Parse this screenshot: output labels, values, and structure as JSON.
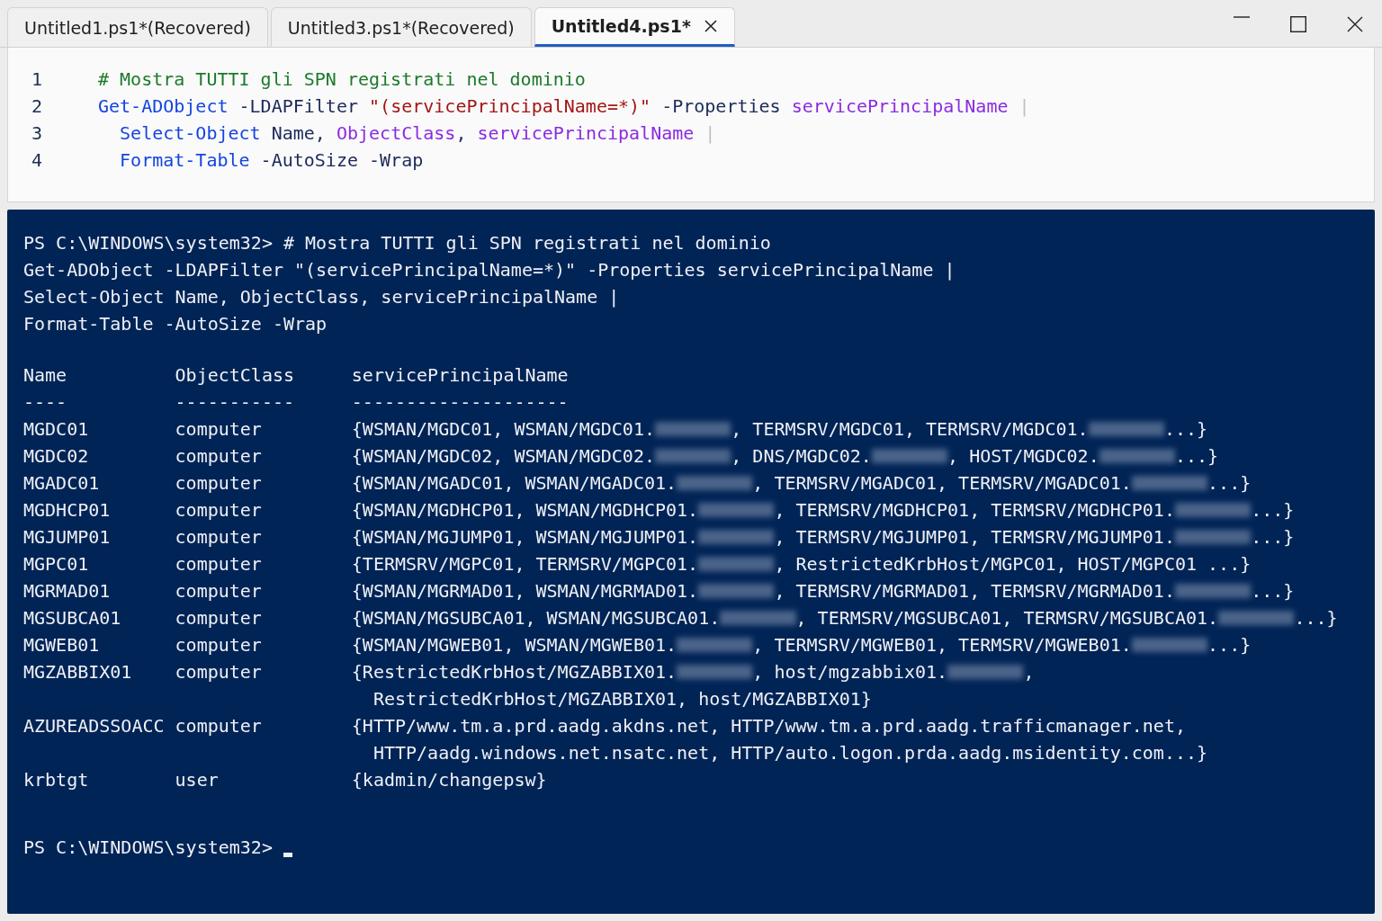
{
  "tabs": [
    {
      "label": "Untitled1.ps1*(Recovered)",
      "selected": false
    },
    {
      "label": "Untitled3.ps1*(Recovered)",
      "selected": false
    },
    {
      "label": "Untitled4.ps1*",
      "selected": true
    }
  ],
  "editor": {
    "lines": [
      {
        "number": "1",
        "tokens": [
          {
            "kind": "comment",
            "text": "# Mostra TUTTI gli SPN registrati nel dominio"
          }
        ]
      },
      {
        "number": "2",
        "tokens": [
          {
            "kind": "cmdlet",
            "text": "Get-ADObject"
          },
          {
            "kind": "param",
            "text": " -LDAPFilter "
          },
          {
            "kind": "string",
            "text": "\"(servicePrincipalName=*)\""
          },
          {
            "kind": "param",
            "text": " -Properties "
          },
          {
            "kind": "property",
            "text": "servicePrincipalName"
          },
          {
            "kind": "pipe",
            "text": " |"
          }
        ]
      },
      {
        "number": "3",
        "tokens": [
          {
            "kind": "cmdlet",
            "text": "  Select-Object"
          },
          {
            "kind": "param",
            "text": " Name, "
          },
          {
            "kind": "property",
            "text": "ObjectClass"
          },
          {
            "kind": "param",
            "text": ", "
          },
          {
            "kind": "property",
            "text": "servicePrincipalName"
          },
          {
            "kind": "pipe",
            "text": " |"
          }
        ]
      },
      {
        "number": "4",
        "tokens": [
          {
            "kind": "cmdlet",
            "text": "  Format-Table"
          },
          {
            "kind": "param",
            "text": " -AutoSize -Wrap"
          }
        ]
      }
    ]
  },
  "console": {
    "echo": [
      "PS C:\\WINDOWS\\system32> # Mostra TUTTI gli SPN registrati nel dominio",
      "Get-ADObject -LDAPFilter \"(servicePrincipalName=*)\" -Properties servicePrincipalName |",
      "Select-Object Name, ObjectClass, servicePrincipalName |",
      "Format-Table -AutoSize -Wrap"
    ],
    "table": {
      "columns": [
        "Name",
        "ObjectClass",
        "servicePrincipalName"
      ],
      "underlines": [
        "----",
        "-----------",
        "--------------------"
      ],
      "rows": [
        {
          "name": "MGDC01",
          "object_class": "computer",
          "spn_lines": [
            [
              {
                "kind": "text",
                "text": "{WSMAN/MGDC01, WSMAN/MGDC01."
              },
              {
                "kind": "redacted"
              },
              {
                "kind": "text",
                "text": ", TERMSRV/MGDC01, TERMSRV/MGDC01."
              },
              {
                "kind": "redacted"
              },
              {
                "kind": "text",
                "text": "...}"
              }
            ]
          ]
        },
        {
          "name": "MGDC02",
          "object_class": "computer",
          "spn_lines": [
            [
              {
                "kind": "text",
                "text": "{WSMAN/MGDC02, WSMAN/MGDC02."
              },
              {
                "kind": "redacted"
              },
              {
                "kind": "text",
                "text": ", DNS/MGDC02."
              },
              {
                "kind": "redacted"
              },
              {
                "kind": "text",
                "text": ", HOST/MGDC02."
              },
              {
                "kind": "redacted"
              },
              {
                "kind": "text",
                "text": "...}"
              }
            ]
          ]
        },
        {
          "name": "MGADC01",
          "object_class": "computer",
          "spn_lines": [
            [
              {
                "kind": "text",
                "text": "{WSMAN/MGADC01, WSMAN/MGADC01."
              },
              {
                "kind": "redacted"
              },
              {
                "kind": "text",
                "text": ", TERMSRV/MGADC01, TERMSRV/MGADC01."
              },
              {
                "kind": "redacted"
              },
              {
                "kind": "text",
                "text": "...}"
              }
            ]
          ]
        },
        {
          "name": "MGDHCP01",
          "object_class": "computer",
          "spn_lines": [
            [
              {
                "kind": "text",
                "text": "{WSMAN/MGDHCP01, WSMAN/MGDHCP01."
              },
              {
                "kind": "redacted"
              },
              {
                "kind": "text",
                "text": ", TERMSRV/MGDHCP01, TERMSRV/MGDHCP01."
              },
              {
                "kind": "redacted"
              },
              {
                "kind": "text",
                "text": "...}"
              }
            ]
          ]
        },
        {
          "name": "MGJUMP01",
          "object_class": "computer",
          "spn_lines": [
            [
              {
                "kind": "text",
                "text": "{WSMAN/MGJUMP01, WSMAN/MGJUMP01."
              },
              {
                "kind": "redacted"
              },
              {
                "kind": "text",
                "text": ", TERMSRV/MGJUMP01, TERMSRV/MGJUMP01."
              },
              {
                "kind": "redacted"
              },
              {
                "kind": "text",
                "text": "...}"
              }
            ]
          ]
        },
        {
          "name": "MGPC01",
          "object_class": "computer",
          "spn_lines": [
            [
              {
                "kind": "text",
                "text": "{TERMSRV/MGPC01, TERMSRV/MGPC01."
              },
              {
                "kind": "redacted"
              },
              {
                "kind": "text",
                "text": ", RestrictedKrbHost/MGPC01, HOST/MGPC01 ...}"
              }
            ]
          ]
        },
        {
          "name": "MGRMAD01",
          "object_class": "computer",
          "spn_lines": [
            [
              {
                "kind": "text",
                "text": "{WSMAN/MGRMAD01, WSMAN/MGRMAD01."
              },
              {
                "kind": "redacted"
              },
              {
                "kind": "text",
                "text": ", TERMSRV/MGRMAD01, TERMSRV/MGRMAD01."
              },
              {
                "kind": "redacted"
              },
              {
                "kind": "text",
                "text": "...}"
              }
            ]
          ]
        },
        {
          "name": "MGSUBCA01",
          "object_class": "computer",
          "spn_lines": [
            [
              {
                "kind": "text",
                "text": "{WSMAN/MGSUBCA01, WSMAN/MGSUBCA01."
              },
              {
                "kind": "redacted"
              },
              {
                "kind": "text",
                "text": ", TERMSRV/MGSUBCA01, TERMSRV/MGSUBCA01."
              },
              {
                "kind": "redacted"
              },
              {
                "kind": "text",
                "text": "...}"
              }
            ]
          ]
        },
        {
          "name": "MGWEB01",
          "object_class": "computer",
          "spn_lines": [
            [
              {
                "kind": "text",
                "text": "{WSMAN/MGWEB01, WSMAN/MGWEB01."
              },
              {
                "kind": "redacted"
              },
              {
                "kind": "text",
                "text": ", TERMSRV/MGWEB01, TERMSRV/MGWEB01."
              },
              {
                "kind": "redacted"
              },
              {
                "kind": "text",
                "text": "...}"
              }
            ]
          ]
        },
        {
          "name": "MGZABBIX01",
          "object_class": "computer",
          "spn_lines": [
            [
              {
                "kind": "text",
                "text": "{RestrictedKrbHost/MGZABBIX01."
              },
              {
                "kind": "redacted"
              },
              {
                "kind": "text",
                "text": ", host/mgzabbix01."
              },
              {
                "kind": "redacted"
              },
              {
                "kind": "text",
                "text": ","
              }
            ],
            [
              {
                "kind": "text",
                "text": "RestrictedKrbHost/MGZABBIX01, host/MGZABBIX01}"
              }
            ]
          ]
        },
        {
          "name": "AZUREADSSOACC",
          "object_class": "computer",
          "spn_lines": [
            [
              {
                "kind": "text",
                "text": "{HTTP/www.tm.a.prd.aadg.akdns.net, HTTP/www.tm.a.prd.aadg.trafficmanager.net,"
              }
            ],
            [
              {
                "kind": "text",
                "text": "HTTP/aadg.windows.net.nsatc.net, HTTP/auto.logon.prda.aadg.msidentity.com...}"
              }
            ]
          ]
        },
        {
          "name": "krbtgt",
          "object_class": "user",
          "spn_lines": [
            [
              {
                "kind": "text",
                "text": "{kadmin/changepsw}"
              }
            ]
          ]
        }
      ]
    },
    "prompt": "PS C:\\WINDOWS\\system32>",
    "cursor": true
  }
}
